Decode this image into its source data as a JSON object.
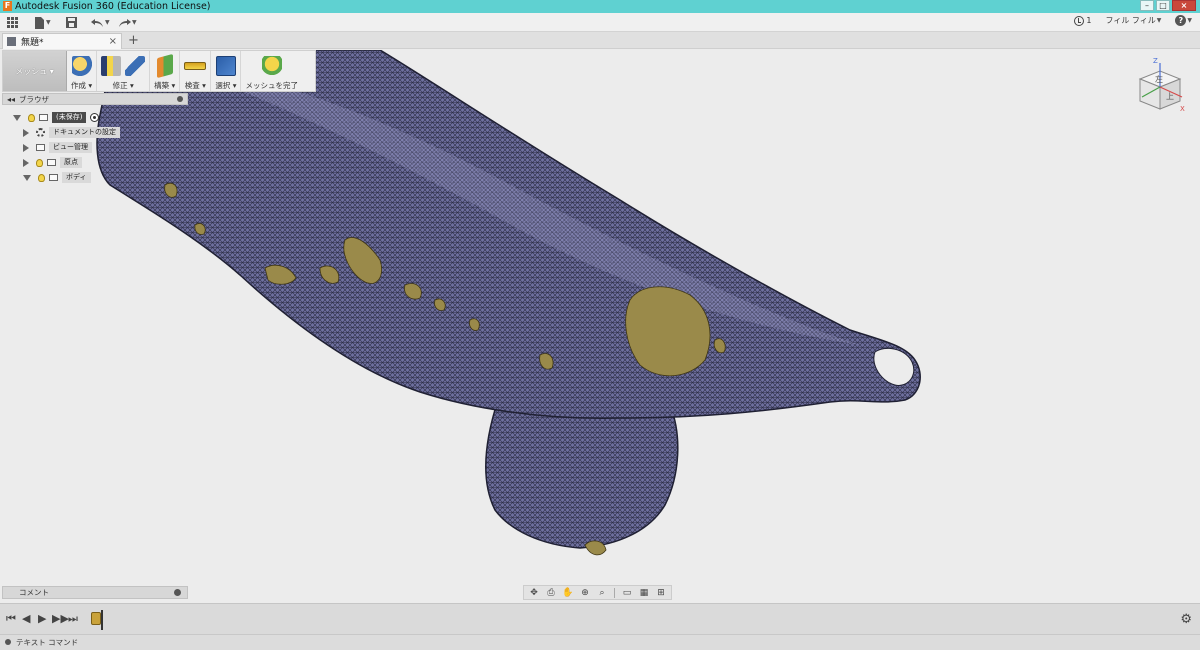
{
  "window": {
    "title": "Autodesk Fusion 360 (Education License)",
    "app_icon_letter": "F",
    "controls": [
      "–",
      "□",
      "×"
    ]
  },
  "quick_access": {
    "job_count": "1",
    "user_name": "フィル フィル",
    "help_label": "?"
  },
  "tab": {
    "name": "無題*",
    "close": "×",
    "new_tab": "+"
  },
  "ribbon": {
    "workspace": "メッシュ ▾",
    "groups": [
      {
        "label": "作成 ▾"
      },
      {
        "label": "修正 ▾"
      },
      {
        "label": "構築 ▾"
      },
      {
        "label": "検査 ▾"
      },
      {
        "label": "選択 ▾"
      },
      {
        "label": "メッシュを完了"
      }
    ]
  },
  "browser": {
    "collapse_glyph": "◂◂",
    "title": "ブラウザ",
    "root": "(未保存)",
    "nodes": [
      "ドキュメントの設定",
      "ビュー管理",
      "原点",
      "ボディ"
    ]
  },
  "viewcube": {
    "top_face": "左",
    "front_face": "上",
    "axis_z": "Z",
    "axis_x": "X"
  },
  "comments": {
    "title": "コメント"
  },
  "timeline": {
    "controls": [
      "⏮",
      "◀",
      "▶",
      "▶▶",
      "⏭"
    ]
  },
  "text_commands": {
    "label": "テキスト コマンド"
  },
  "colors": {
    "title_bar": "#5fd1d1",
    "mesh_body": "#6e6f9e",
    "mesh_defects": "#9a8a4a",
    "viewport_bg": "#ececec"
  }
}
